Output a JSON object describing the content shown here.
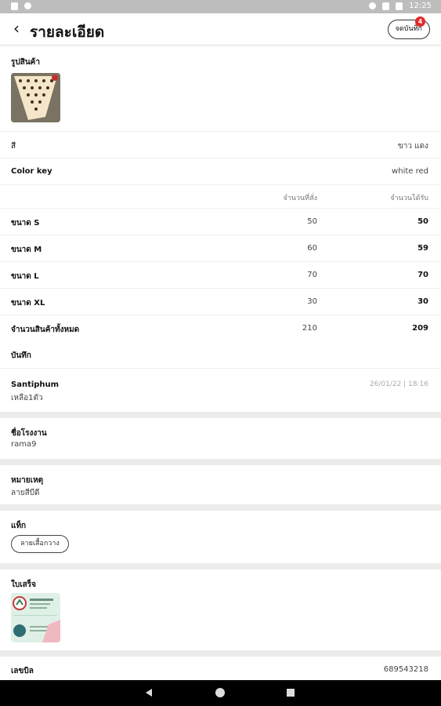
{
  "status_bar": {
    "time": "12:25"
  },
  "header": {
    "title": "รายละเอียด",
    "note_button": "จดบันทึก",
    "note_badge": "4"
  },
  "product_photo": {
    "label": "รูปสินค้า"
  },
  "details": [
    {
      "label": "สี",
      "value": "ขาว แดง"
    },
    {
      "label": "Color key",
      "value": "white red"
    }
  ],
  "size_table": {
    "col_ordered": "จำนวนที่สั่ง",
    "col_received": "จำนวนได้รับ",
    "rows": [
      {
        "label": "ขนาด S",
        "ordered": "50",
        "received": "50"
      },
      {
        "label": "ขนาด M",
        "ordered": "60",
        "received": "59"
      },
      {
        "label": "ขนาด L",
        "ordered": "70",
        "received": "70"
      },
      {
        "label": "ขนาด XL",
        "ordered": "30",
        "received": "30"
      }
    ],
    "total": {
      "label": "จำนวนสินค้าทั้งหมด",
      "ordered": "210",
      "received": "209"
    }
  },
  "notes": {
    "title": "บันทึก",
    "items": [
      {
        "author": "Santiphum",
        "message": "เหลือ1ตัว",
        "timestamp": "26/01/22 | 18:16"
      }
    ]
  },
  "factory": {
    "label": "ชื่อโรงงาน",
    "value": "rama9"
  },
  "remark": {
    "label": "หมายเหตุ",
    "value": "ลายสีบีดี"
  },
  "tags": {
    "label": "แท็ก",
    "items": [
      "ลายเสื้อกวาง"
    ]
  },
  "invoice": {
    "label": "ใบเสร็จ"
  },
  "bill": {
    "label": "เลขบิล",
    "value": "689543218"
  },
  "colors": {
    "badge": "#e52727",
    "divider": "#ececec"
  }
}
